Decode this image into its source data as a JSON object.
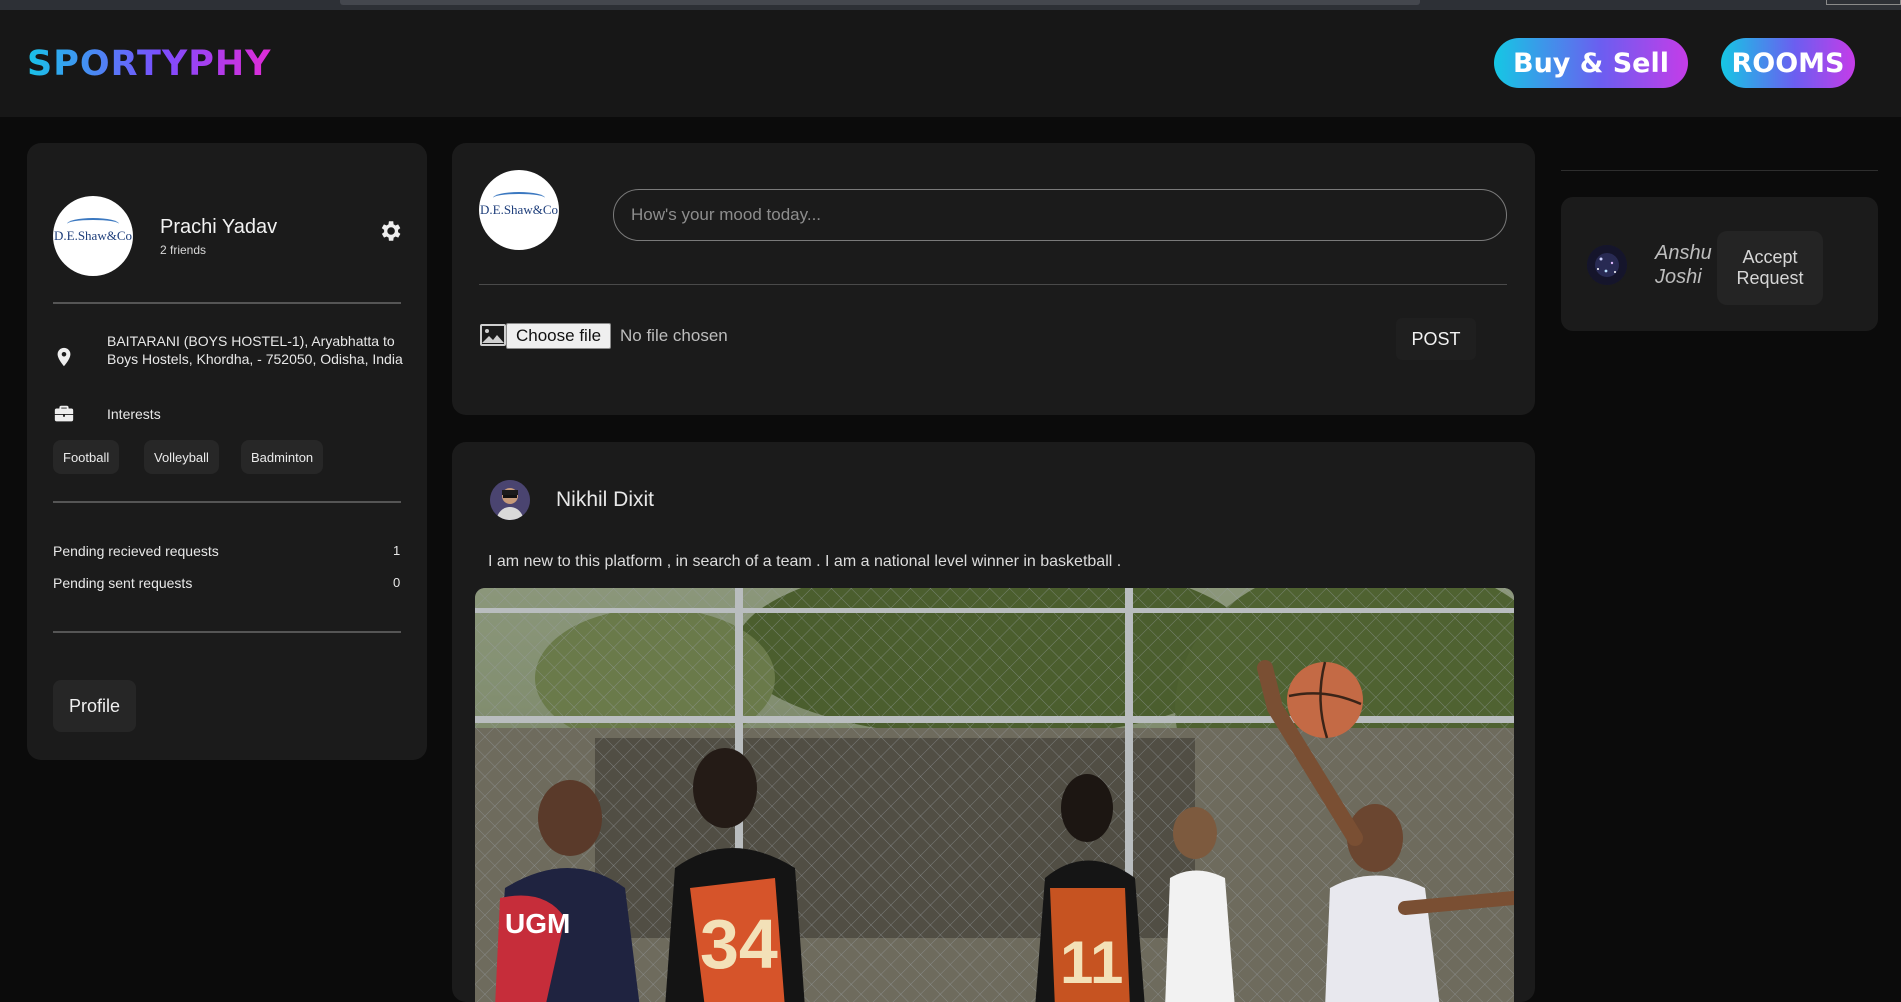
{
  "navbar": {
    "brand": "SPORTYPHY",
    "buy_sell_label": "Buy & Sell",
    "rooms_label": "ROOMS"
  },
  "profile_card": {
    "avatar_logo_text": "D.E.Shaw&Co",
    "name": "Prachi Yadav",
    "friends": "2 friends",
    "address": "BAITARANI (BOYS HOSTEL-1), Aryabhatta to Boys Hostels, Khordha, - 752050, Odisha, India",
    "interests_label": "Interests",
    "interests": [
      "Football",
      "Volleyball",
      "Badminton"
    ],
    "pending_received_label": "Pending recieved requests",
    "pending_received_count": "1",
    "pending_sent_label": "Pending sent requests",
    "pending_sent_count": "0",
    "profile_button": "Profile"
  },
  "composer": {
    "avatar_logo_text": "D.E.Shaw&Co",
    "placeholder": "How's your mood today...",
    "choose_file_label": "Choose file",
    "no_file_text": "No file chosen",
    "post_label": "POST"
  },
  "post": {
    "author": "Nikhil Dixit",
    "text": "I am new to this platform , in search of a team . I am a national level winner in basketball ."
  },
  "friend_request": {
    "name": "Anshu Joshi",
    "accept_label": "Accept Request"
  },
  "colors": {
    "accent_cyan": "#15c7e4",
    "accent_purple": "#7c4dff",
    "accent_pink": "#e22bd6",
    "background": "#0b0b0b",
    "card": "#1b1b1b"
  }
}
